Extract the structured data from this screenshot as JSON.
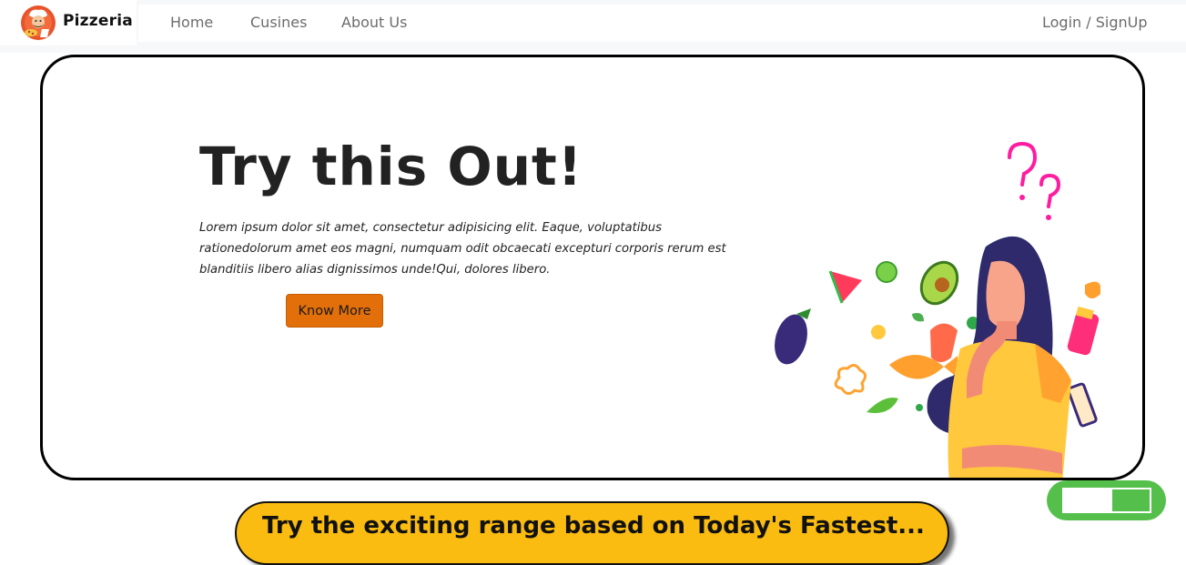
{
  "brand": {
    "name": "Pizzeria",
    "logo_icon": "chef-pizza-logo"
  },
  "nav": {
    "home": "Home",
    "cuisines": "Cusines",
    "about": "About Us",
    "login": "Login / SignUp"
  },
  "hero": {
    "title": "Try this Out!",
    "description": "Lorem ipsum dolor sit amet, consectetur adipisicing elit. Eaque, voluptatibus rationedolorum amet eos magni, numquam odit obcaecati excepturi corporis rerum est blanditiis libero alias dignissimos unde!Qui, dolores libero.",
    "cta": "Know More",
    "illustration_icon": "thinking-woman-food-illustration"
  },
  "banner": {
    "text": "Try the exciting range based on Today's Fastest..."
  },
  "colors": {
    "accent_orange": "#e36f0b",
    "banner_yellow": "#fbbc11",
    "toggle_green": "#54c04b",
    "text_dark": "#222222"
  }
}
